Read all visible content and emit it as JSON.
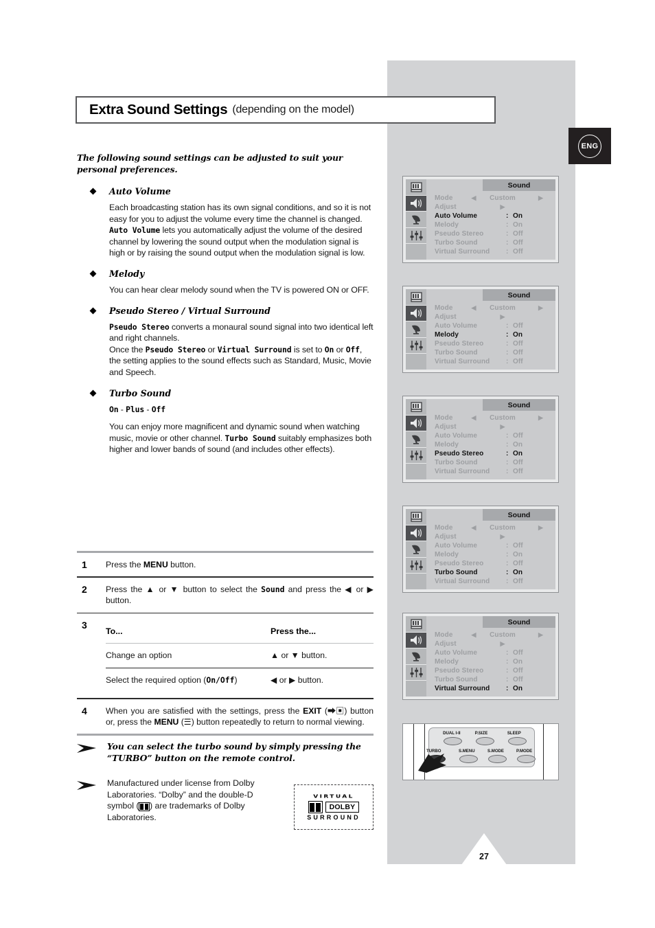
{
  "page": {
    "language_badge": "ENG",
    "number": "27"
  },
  "header": {
    "title": "Extra Sound Settings",
    "subtitle": "(depending on the model)"
  },
  "intro": "The following sound settings can be adjusted to suit your personal preferences.",
  "sections": [
    {
      "heading": "Auto Volume",
      "body_html": "Each broadcasting station has its own signal conditions, and so it is not easy for you to adjust the volume every time the channel is changed. <span class=\"mono\">Auto Volume</span> lets you automatically adjust the volume of the desired channel by lowering the sound output when the modulation signal is high or by raising the sound output when the modulation signal is low."
    },
    {
      "heading": "Melody",
      "body_html": "You can hear clear melody sound when the TV is powered ON or OFF."
    },
    {
      "heading": "Pseudo Stereo / Virtual Surround",
      "body_html": "<span class=\"mono\">Pseudo Stereo</span> converts a monaural sound signal into two identical left and right channels.<br>Once the <span class=\"mono\">Pseudo Stereo</span> or <span class=\"mono\">Virtual Surround</span> is set to <span class=\"mono\">On</span> or <span class=\"mono\">Off</span>, the setting applies to the sound effects such as Standard, Music, Movie and Speech."
    },
    {
      "heading": "Turbo Sound",
      "mono_line_html": "<span class=\"mono\">On</span> - <span class=\"mono\">Plus</span> - <span class=\"mono\">Off</span>",
      "body_html": "You can enjoy more magnificent and dynamic sound when watching music, movie or other channel. <span class=\"mono\">Turbo Sound</span> suitably emphasizes both higher and lower bands of sound (and includes other effects)."
    }
  ],
  "steps": [
    {
      "number": "1",
      "text_html": "Press the <span class=\"b\">MENU</span> button."
    },
    {
      "number": "2",
      "text_html": "Press the ▲ or ▼ button to select the <span class=\"mono\">Sound</span> and press the ◀ or ▶ button."
    },
    {
      "number": "3",
      "table": {
        "headers": [
          "To...",
          "Press the..."
        ],
        "rows": [
          [
            "Change an option",
            "▲ or ▼ button."
          ],
          [
            "Select the required option (<span class=\"mono\">On/Off</span>)",
            "◀ or ▶ button."
          ]
        ]
      }
    },
    {
      "number": "4",
      "text_html": "When you are satisfied with the settings, press the <span class=\"b\">EXIT</span> (⮕▣) button or, press the <span class=\"b\">MENU</span> (☰) button repeatedly to return to normal viewing."
    }
  ],
  "notes": [
    {
      "style": "emphasis",
      "text": "You can select the turbo sound by simply pressing the “TURBO” button on the remote control."
    },
    {
      "style": "plain",
      "text_html": "Manufactured under license from Dolby Laboratories. “Dolby” and the double-D symbol (<span class=\"inline-dd\"></span>) are trademarks of Dolby Laboratories."
    }
  ],
  "dolby_logo": {
    "top": "VIRTUAL",
    "word": "DOLBY",
    "bottom": "SURROUND"
  },
  "osd_panels": [
    {
      "title": "Sound",
      "active_index": 2,
      "rows": [
        {
          "label": "Mode",
          "type": "mode",
          "value": "Custom",
          "arrow_left": "◀",
          "arrow_right": "▶"
        },
        {
          "label": "Adjust",
          "type": "adjust",
          "value": "▶"
        },
        {
          "label": "Auto Volume",
          "type": "value",
          "value": "On"
        },
        {
          "label": "Melody",
          "type": "value",
          "value": "On"
        },
        {
          "label": "Pseudo Stereo",
          "type": "value",
          "value": "Off"
        },
        {
          "label": "Turbo Sound",
          "type": "value",
          "value": "Off"
        },
        {
          "label": "Virtual Surround",
          "type": "value",
          "value": "Off"
        }
      ]
    },
    {
      "title": "Sound",
      "active_index": 3,
      "rows": [
        {
          "label": "Mode",
          "type": "mode",
          "value": "Custom",
          "arrow_left": "◀",
          "arrow_right": "▶"
        },
        {
          "label": "Adjust",
          "type": "adjust",
          "value": "▶"
        },
        {
          "label": "Auto Volume",
          "type": "value",
          "value": "Off"
        },
        {
          "label": "Melody",
          "type": "value",
          "value": "On"
        },
        {
          "label": "Pseudo Stereo",
          "type": "value",
          "value": "Off"
        },
        {
          "label": "Turbo Sound",
          "type": "value",
          "value": "Off"
        },
        {
          "label": "Virtual Surround",
          "type": "value",
          "value": "Off"
        }
      ]
    },
    {
      "title": "Sound",
      "active_index": 4,
      "rows": [
        {
          "label": "Mode",
          "type": "mode",
          "value": "Custom",
          "arrow_left": "◀",
          "arrow_right": "▶"
        },
        {
          "label": "Adjust",
          "type": "adjust",
          "value": "▶"
        },
        {
          "label": "Auto Volume",
          "type": "value",
          "value": "Off"
        },
        {
          "label": "Melody",
          "type": "value",
          "value": "On"
        },
        {
          "label": "Pseudo Stereo",
          "type": "value",
          "value": "On"
        },
        {
          "label": "Turbo Sound",
          "type": "value",
          "value": "Off"
        },
        {
          "label": "Virtual Surround",
          "type": "value",
          "value": "Off"
        }
      ]
    },
    {
      "title": "Sound",
      "active_index": 5,
      "rows": [
        {
          "label": "Mode",
          "type": "mode",
          "value": "Custom",
          "arrow_left": "◀",
          "arrow_right": "▶"
        },
        {
          "label": "Adjust",
          "type": "adjust",
          "value": "▶"
        },
        {
          "label": "Auto Volume",
          "type": "value",
          "value": "Off"
        },
        {
          "label": "Melody",
          "type": "value",
          "value": "On"
        },
        {
          "label": "Pseudo Stereo",
          "type": "value",
          "value": "Off"
        },
        {
          "label": "Turbo Sound",
          "type": "value",
          "value": "On"
        },
        {
          "label": "Virtual Surround",
          "type": "value",
          "value": "Off"
        }
      ]
    },
    {
      "title": "Sound",
      "active_index": 6,
      "rows": [
        {
          "label": "Mode",
          "type": "mode",
          "value": "Custom",
          "arrow_left": "◀",
          "arrow_right": "▶"
        },
        {
          "label": "Adjust",
          "type": "adjust",
          "value": "▶"
        },
        {
          "label": "Auto Volume",
          "type": "value",
          "value": "Off"
        },
        {
          "label": "Melody",
          "type": "value",
          "value": "On"
        },
        {
          "label": "Pseudo Stereo",
          "type": "value",
          "value": "Off"
        },
        {
          "label": "Turbo Sound",
          "type": "value",
          "value": "Off"
        },
        {
          "label": "Virtual Surround",
          "type": "value",
          "value": "On"
        }
      ]
    }
  ],
  "osd_icons": [
    "picture-icon",
    "speaker-icon",
    "satellite-dish-icon",
    "equalizer-icon",
    "blank-icon"
  ],
  "remote": {
    "top_row": [
      "DUAL I-II",
      "P.SIZE",
      "SLEEP"
    ],
    "bottom_row": [
      "TURBO",
      "S.MENU",
      "S.MODE",
      "P.MODE"
    ],
    "highlighted_button": "TURBO"
  },
  "colors": {
    "panel_gray": "#d2d3d5",
    "osd_body": "#cacbcd",
    "osd_title": "#a7a9ac",
    "osd_dim_text": "#9d9fa2",
    "osd_active_text": "#111111",
    "badge_bg": "#231f20"
  }
}
